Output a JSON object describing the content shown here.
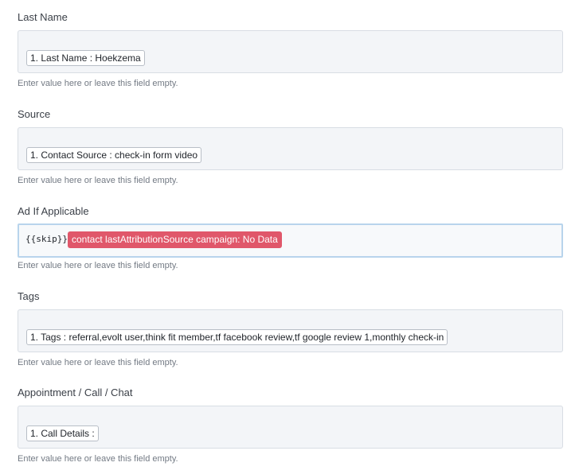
{
  "fields": [
    {
      "label": "Last Name",
      "token": "1. Last Name : Hoekzema",
      "hint": "Enter value here or leave this field empty."
    },
    {
      "label": "Source",
      "token": "1. Contact Source : check-in form video",
      "hint": "Enter value here or leave this field empty."
    },
    {
      "label": "Ad If Applicable",
      "skip_text": "{{skip}}",
      "error_token": "contact lastAttributionSource campaign: No Data",
      "hint": "Enter value here or leave this field empty."
    },
    {
      "label": "Tags",
      "token": "1. Tags : referral,evolt user,think fit member,tf facebook review,tf google review 1,monthly check-in",
      "hint": "Enter value here or leave this field empty."
    },
    {
      "label": "Appointment / Call / Chat",
      "token": "1. Call Details :",
      "hint": "Enter value here or leave this field empty."
    }
  ],
  "colors": {
    "error_token_bg": "#e0576a",
    "focused_border": "#b8d4ec",
    "field_bg": "#f3f5f8"
  }
}
